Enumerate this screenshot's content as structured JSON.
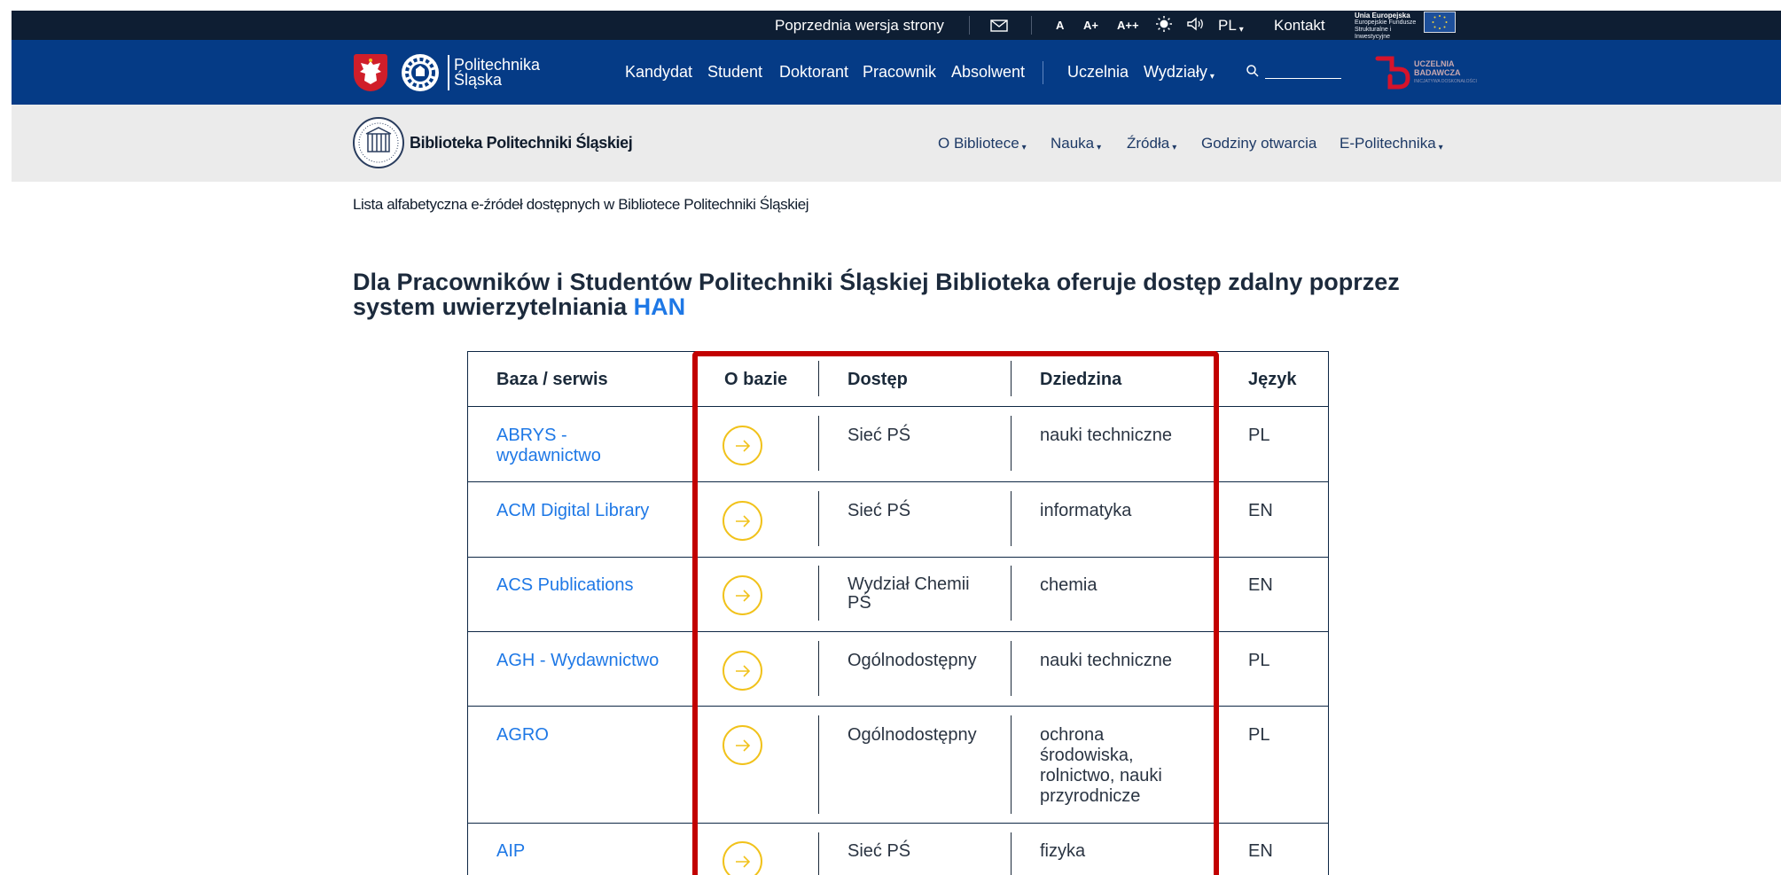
{
  "topbar": {
    "prev_version": "Poprzednia wersja strony",
    "font_small": "A",
    "font_medium": "A+",
    "font_large": "A++",
    "language": "PL",
    "contact": "Kontakt",
    "eu_title": "Unia Europejska",
    "eu_sub1": "Europejskie Fundusze",
    "eu_sub2": "Strukturalne i Inwestycyjne"
  },
  "mainnav": {
    "brand_line1": "Politechnika",
    "brand_line2": "Śląska",
    "items": [
      "Kandydat",
      "Student",
      "Doktorant",
      "Pracownik",
      "Absolwent",
      "Uczelnia",
      "Wydziały"
    ],
    "search_placeholder": "",
    "ub_line1": "UCZELNIA",
    "ub_line2": "BADAWCZA",
    "ub_line3": "INICJATYWA DOSKONAŁOŚCI"
  },
  "libbar": {
    "name": "Biblioteka Politechniki Śląskiej",
    "items": [
      "O Bibliotece",
      "Nauka",
      "Źródła",
      "Godziny otwarcia",
      "E-Politechnika"
    ]
  },
  "breadcrumb": "Lista alfabetyczna e-źródeł dostępnych w Bibliotece Politechniki Śląskiej",
  "headline": {
    "text": "Dla Pracowników i Studentów Politechniki Śląskiej Biblioteka oferuje dostęp zdalny poprzez system uwierzytelniania ",
    "link": "HAN"
  },
  "table": {
    "headers": [
      "Baza / serwis",
      "O bazie",
      "Dostęp",
      "Dziedzina",
      "Język"
    ],
    "rows": [
      {
        "name": "ABRYS - wydawnictwo",
        "access": "Sieć PŚ",
        "domain": "nauki techniczne",
        "lang": "PL"
      },
      {
        "name": "ACM Digital Library",
        "access": "Sieć PŚ",
        "domain": "informatyka",
        "lang": "EN"
      },
      {
        "name": "ACS Publications",
        "access": "Wydział Chemii PŚ",
        "domain": "chemia",
        "lang": "EN"
      },
      {
        "name": "AGH - Wydawnictwo",
        "access": "Ogólnodostępny",
        "domain": "nauki techniczne",
        "lang": "PL"
      },
      {
        "name": "AGRO",
        "access": "Ogólnodostępny",
        "domain": "ochrona środowiska, rolnictwo, nauki przyrodnicze",
        "lang": "PL"
      },
      {
        "name": "AIP",
        "access": "Sieć PŚ",
        "domain": "fizyka",
        "lang": "EN"
      }
    ]
  },
  "colors": {
    "topbar_bg": "#0e1e33",
    "nav_bg": "#053b86",
    "libbar_bg": "#ebebeb",
    "link": "#1e78e6",
    "arrow_ring": "#f1c21b",
    "highlight": "#c20000"
  }
}
